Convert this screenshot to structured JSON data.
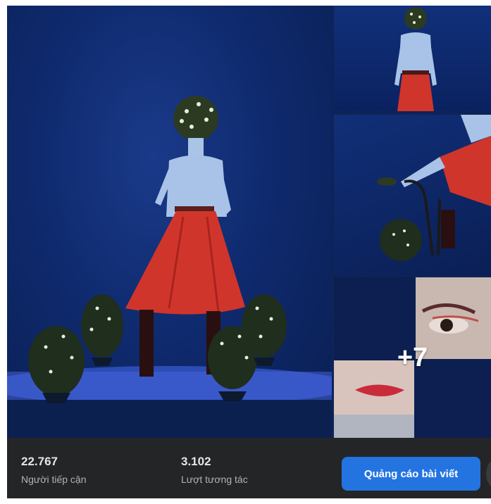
{
  "gallery": {
    "extra_count": "+7"
  },
  "stats": {
    "reach_value": "22.767",
    "reach_label": "Người tiếp cận",
    "engagement_value": "3.102",
    "engagement_label": "Lượt tương tác"
  },
  "actions": {
    "boost_label": "Quảng cáo bài viết"
  },
  "colors": {
    "accent": "#2374e1",
    "background": "#242526",
    "gallery_bg": "#0e2357",
    "skirt": "#d0352b"
  }
}
